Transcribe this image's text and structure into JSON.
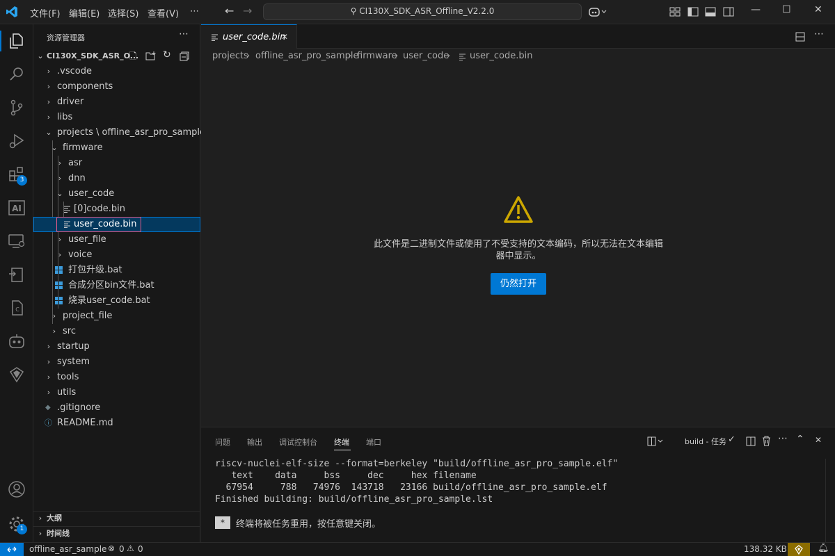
{
  "menu": [
    "文件(F)",
    "编辑(E)",
    "选择(S)",
    "查看(V)",
    "⋯"
  ],
  "command_center": "CI130X_SDK_ASR_Offline_V2.2.0",
  "activity_badges": {
    "extensions": "3",
    "settings": "1"
  },
  "sidebar": {
    "title": "资源管理器",
    "root": "CI130X_SDK_ASR_O...",
    "rows": [
      {
        "label": ".vscode",
        "chev": "›"
      },
      {
        "label": "components",
        "chev": "›"
      },
      {
        "label": "driver",
        "chev": "›"
      },
      {
        "label": "libs",
        "chev": "›"
      },
      {
        "label": "projects \\ offline_asr_pro_sample",
        "chev": "⌄"
      },
      {
        "label": "firmware",
        "chev": "⌄"
      },
      {
        "label": "asr",
        "chev": "›"
      },
      {
        "label": "dnn",
        "chev": "›"
      },
      {
        "label": "user_code",
        "chev": "⌄"
      },
      {
        "label": "[0]code.bin",
        "chev": ""
      },
      {
        "label": "user_code.bin",
        "chev": ""
      },
      {
        "label": "user_file",
        "chev": "›"
      },
      {
        "label": "voice",
        "chev": "›"
      },
      {
        "label": "打包升级.bat",
        "chev": ""
      },
      {
        "label": "合成分区bin文件.bat",
        "chev": ""
      },
      {
        "label": "烧录user_code.bat",
        "chev": ""
      },
      {
        "label": "project_file",
        "chev": "›"
      },
      {
        "label": "src",
        "chev": "›"
      },
      {
        "label": "startup",
        "chev": "›"
      },
      {
        "label": "system",
        "chev": "›"
      },
      {
        "label": "tools",
        "chev": "›"
      },
      {
        "label": "utils",
        "chev": "›"
      },
      {
        "label": ".gitignore",
        "chev": ""
      },
      {
        "label": "README.md",
        "chev": ""
      }
    ],
    "outline": "大纲",
    "timeline": "时间线"
  },
  "tab": {
    "label": "user_code.bin",
    "close": "✕"
  },
  "breadcrumb": [
    "projects",
    "offline_asr_pro_sample",
    "firmware",
    "user_code",
    "user_code.bin"
  ],
  "editor": {
    "message_line1": "此文件是二进制文件或使用了不受支持的文本编码，所以无法在文本编辑",
    "message_line2": "器中显示。",
    "button": "仍然打开"
  },
  "panel": {
    "tabs": [
      "问题",
      "输出",
      "调试控制台",
      "终端",
      "端口"
    ],
    "active_tab": "终端",
    "task": "build - 任务",
    "terminal_lines": [
      "riscv-nuclei-elf-size --format=berkeley \"build/offline_asr_pro_sample.elf\"",
      "   text    data     bss     dec     hex filename",
      "  67954     788   74976  143718   23166 build/offline_asr_pro_sample.elf",
      "Finished building: build/offline_asr_pro_sample.lst"
    ],
    "terminal_notice": "终端将被任务重用，按任意键关闭。",
    "terminal_star": "*"
  },
  "status": {
    "project": "offline_asr_sample",
    "errors": "0",
    "warnings": "0",
    "size": "138.32 KB"
  },
  "colors": {
    "accent": "#0078d4",
    "warning": "#cca700"
  }
}
